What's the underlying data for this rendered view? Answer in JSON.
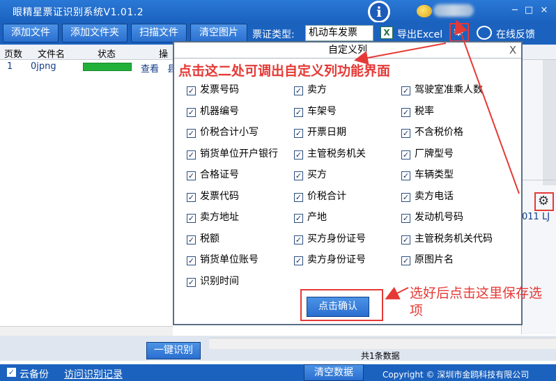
{
  "titlebar": {
    "title": "眼精星票证识别系统V1.01.2",
    "info_glyph": "i",
    "min_glyph": "−",
    "max_glyph": "□",
    "close_glyph": "×"
  },
  "toolbar": {
    "add_file": "添加文件",
    "add_folder": "添加文件夹",
    "scan_file": "扫描文件",
    "clear_images": "清空图片",
    "ticket_type_label": "票证类型:",
    "ticket_type_value": "机动车发票",
    "excel_glyph": "X",
    "export_excel": "导出Excel",
    "feedback": "在线反馈"
  },
  "grid": {
    "columns": [
      "页数",
      "文件名",
      "状态",
      "操"
    ],
    "rows": [
      {
        "page": "1",
        "filename": "0jpng",
        "progress": 1.0,
        "view": "查看",
        "extra": "县"
      }
    ],
    "right_partial": "011  LJ"
  },
  "dialog": {
    "title": "自定义列",
    "close": "X",
    "confirm": "点击确认",
    "items": [
      "发票号码",
      "卖方",
      "驾驶室准乘人数",
      "机器编号",
      "车架号",
      "税率",
      "价税合计小写",
      "开票日期",
      "不含税价格",
      "销货单位开户银行",
      "主管税务机关",
      "厂牌型号",
      "合格证号",
      "买方",
      "车辆类型",
      "发票代码",
      "价税合计",
      "卖方电话",
      "卖方地址",
      "产地",
      "发动机号码",
      "税额",
      "买方身份证号",
      "主管税务机关代码",
      "销货单位账号",
      "卖方身份证号",
      "原图片名",
      "识别时间"
    ],
    "check_glyph": "✓"
  },
  "annotations": {
    "top": "点击这二处可调出自定义列功能界面",
    "bottom": "选好后点击这里保存选项"
  },
  "status": {
    "one_click": "一键识别",
    "count": "共1条数据"
  },
  "bottom": {
    "cloud_backup": "云备份",
    "visit_records": "访问识别记录",
    "clear_data": "清空数据",
    "copyright": "Copyright © 深圳市金鸥科技有限公司"
  },
  "colors": {
    "primary": "#1b62bf",
    "button": "#2a6fcf",
    "annotation": "#e53935",
    "progress": "#21b03a"
  },
  "icons": {
    "gear": "gear-icon",
    "chat": "chat-icon",
    "excel": "excel-icon",
    "info": "info-icon"
  }
}
